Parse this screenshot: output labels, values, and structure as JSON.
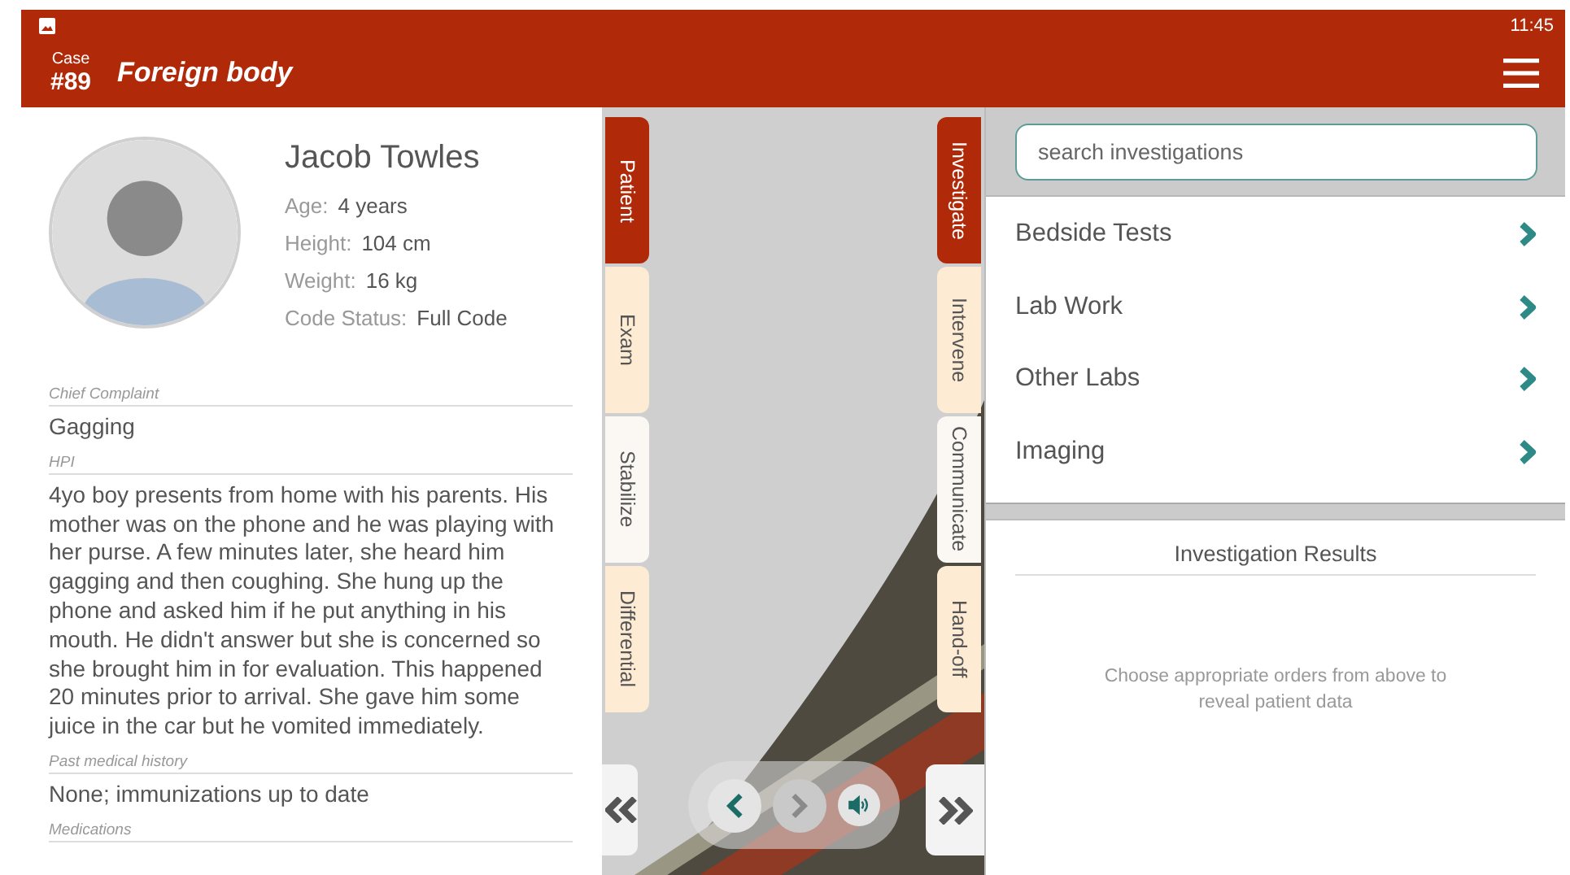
{
  "status_bar": {
    "time": "11:45"
  },
  "header": {
    "case_label": "Case",
    "case_number": "#89",
    "title": "Foreign body"
  },
  "patient": {
    "name": "Jacob Towles",
    "fields": [
      {
        "label": "Age:",
        "value": "4 years"
      },
      {
        "label": "Height:",
        "value": "104 cm"
      },
      {
        "label": "Weight:",
        "value": "16 kg"
      },
      {
        "label": "Code Status:",
        "value": "Full Code"
      }
    ]
  },
  "sections": [
    {
      "label": "Chief Complaint",
      "value": "Gagging"
    },
    {
      "label": "HPI",
      "value": "4yo boy presents from home with his parents. His mother was on the phone and he was playing with her purse. A few minutes later, she heard him gagging and then coughing. She hung up the phone and asked him if he put anything in his mouth. He didn't answer but she is concerned so she brought him in for evaluation. This happened 20 minutes prior to arrival. She gave him some juice in the car but he vomited immediately."
    },
    {
      "label": "Past medical history",
      "value": "None; immunizations up to date"
    },
    {
      "label": "Medications"
    }
  ],
  "left_tabs": [
    {
      "label": "Patient",
      "selected": true,
      "color": "#b02a0a"
    },
    {
      "label": "Exam",
      "selected": false,
      "color": "#fdebd3"
    },
    {
      "label": "Stabilize",
      "selected": false,
      "color": "#fbf8f3"
    },
    {
      "label": "Differential",
      "selected": false,
      "color": "#fdebd3"
    }
  ],
  "right_tabs": [
    {
      "label": "Investigate",
      "selected": true,
      "color": "#b02a0a"
    },
    {
      "label": "Intervene",
      "selected": false,
      "color": "#fdebd3"
    },
    {
      "label": "Communicate",
      "selected": false,
      "color": "#fbf8f3"
    },
    {
      "label": "Hand-off",
      "selected": false,
      "color": "#fdebd3"
    }
  ],
  "scene_controls": {
    "back": {
      "disabled": false
    },
    "forward": {
      "disabled": true
    }
  },
  "search": {
    "placeholder": "search investigations"
  },
  "categories": [
    {
      "label": "Bedside Tests"
    },
    {
      "label": "Lab Work"
    },
    {
      "label": "Other Labs"
    },
    {
      "label": "Imaging"
    }
  ],
  "results": {
    "title": "Investigation Results",
    "message": "Choose appropriate orders from above to reveal patient data"
  }
}
